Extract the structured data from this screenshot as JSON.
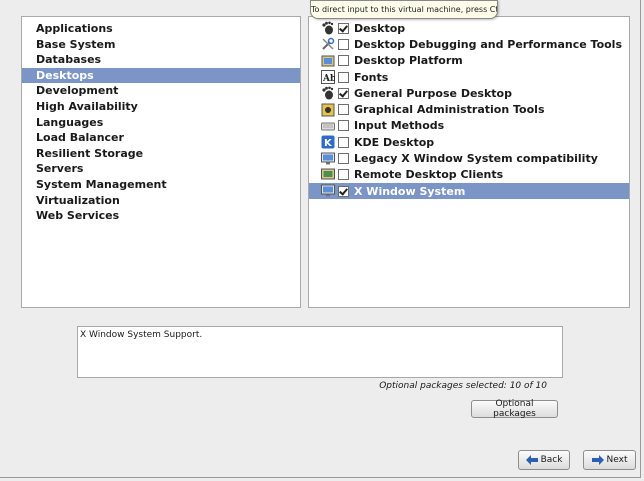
{
  "tooltip": "To direct input to this virtual machine, press Ctrl+G.",
  "categories": [
    {
      "label": "Applications",
      "selected": false
    },
    {
      "label": "Base System",
      "selected": false
    },
    {
      "label": "Databases",
      "selected": false
    },
    {
      "label": "Desktops",
      "selected": true
    },
    {
      "label": "Development",
      "selected": false
    },
    {
      "label": "High Availability",
      "selected": false
    },
    {
      "label": "Languages",
      "selected": false
    },
    {
      "label": "Load Balancer",
      "selected": false
    },
    {
      "label": "Resilient Storage",
      "selected": false
    },
    {
      "label": "Servers",
      "selected": false
    },
    {
      "label": "System Management",
      "selected": false
    },
    {
      "label": "Virtualization",
      "selected": false
    },
    {
      "label": "Web Services",
      "selected": false
    }
  ],
  "packages": [
    {
      "label": "Desktop",
      "checked": true,
      "selected": false,
      "icon": "gnome-foot-icon"
    },
    {
      "label": "Desktop Debugging and Performance Tools",
      "checked": false,
      "selected": false,
      "icon": "tools-icon"
    },
    {
      "label": "Desktop Platform",
      "checked": false,
      "selected": false,
      "icon": "desktop-platform-icon"
    },
    {
      "label": "Fonts",
      "checked": false,
      "selected": false,
      "icon": "fonts-icon"
    },
    {
      "label": "General Purpose Desktop",
      "checked": true,
      "selected": false,
      "icon": "gnome-foot-icon"
    },
    {
      "label": "Graphical Administration Tools",
      "checked": false,
      "selected": false,
      "icon": "admin-tools-icon"
    },
    {
      "label": "Input Methods",
      "checked": false,
      "selected": false,
      "icon": "keyboard-icon"
    },
    {
      "label": "KDE Desktop",
      "checked": false,
      "selected": false,
      "icon": "kde-icon"
    },
    {
      "label": "Legacy X Window System compatibility",
      "checked": false,
      "selected": false,
      "icon": "monitor-icon"
    },
    {
      "label": "Remote Desktop Clients",
      "checked": false,
      "selected": false,
      "icon": "remote-desktop-icon"
    },
    {
      "label": "X Window System",
      "checked": true,
      "selected": true,
      "icon": "monitor-icon"
    }
  ],
  "description": "X Window System Support.",
  "optional_count": "Optional packages selected: 10 of 10",
  "buttons": {
    "optional": "Optional packages",
    "back": "Back",
    "next": "Next"
  },
  "colors": {
    "selection": "#7b95c6",
    "background": "#ededed"
  }
}
